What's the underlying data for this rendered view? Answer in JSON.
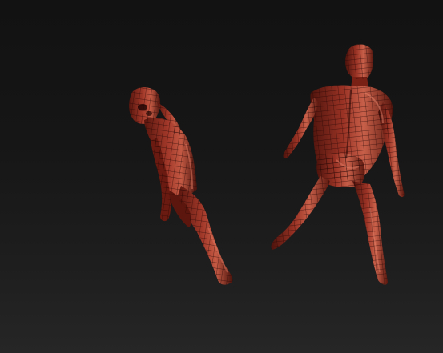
{
  "scene": {
    "background_color": "#1a1a1a",
    "mesh_color": "#8a2a1e",
    "wire_color": "#2a0805",
    "highlight_color": "#c8604a",
    "models": [
      {
        "name": "wireframe-figure-left"
      },
      {
        "name": "wireframe-figure-right"
      }
    ]
  }
}
